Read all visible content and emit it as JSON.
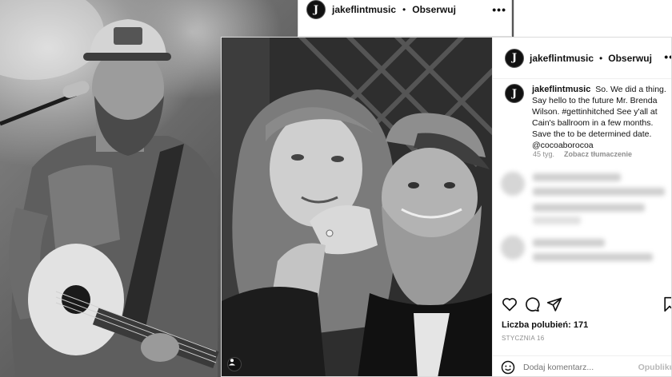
{
  "back_post": {
    "username": "jakeflintmusic",
    "separator": "•",
    "follow_label": "Obserwuj",
    "more_label": "•••",
    "avatar_letter": "J"
  },
  "post": {
    "avatar_letter": "J",
    "username": "jakeflintmusic",
    "separator": "•",
    "follow_label": "Obserwuj",
    "more_label": "•••",
    "caption_username": "jakeflintmusic",
    "caption_lines": [
      "So. We did a thing.",
      "Say hello to the future Mr. Brenda",
      "Wilson. #gettinhitched See y'all at",
      "Cain's ballroom in a few months.",
      "Save the to be determined date.",
      "@cocoaborocoa"
    ],
    "time_ago": "45 tyg.",
    "translate_label": "Zobacz tłumaczenie",
    "likes_label": "Liczba polubień:",
    "likes_count": "171",
    "date": "STYCZNIA 16",
    "comment_placeholder": "Dodaj komentarz...",
    "publish_label": "Opublikuj"
  },
  "icons": [
    "heart-icon",
    "comment-icon",
    "share-icon",
    "bookmark-icon",
    "emoji-icon",
    "tag-user-icon"
  ],
  "colors": {
    "card_bg": "#ffffff",
    "border": "#dbdbdb",
    "muted_text": "#8e8e8e"
  }
}
